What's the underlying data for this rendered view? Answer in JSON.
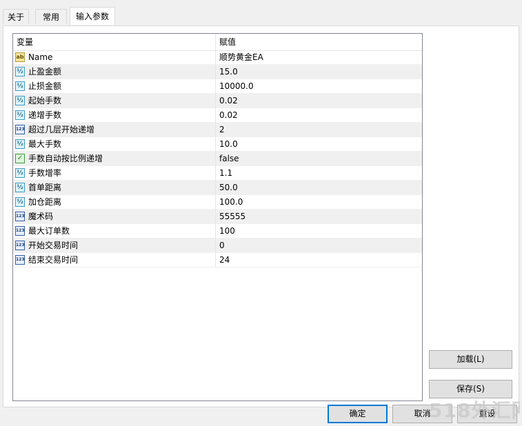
{
  "tabs": [
    {
      "label": "关于",
      "active": false
    },
    {
      "label": "常用",
      "active": false
    },
    {
      "label": "输入参数",
      "active": true
    }
  ],
  "grid": {
    "headers": {
      "variable": "变量",
      "value": "赋值"
    },
    "rows": [
      {
        "type": "abc",
        "icon": "string-type-icon",
        "name": "Name",
        "value": "顺势黄金EA"
      },
      {
        "type": "dbl",
        "icon": "double-type-icon",
        "name": "止盈金额",
        "value": "15.0"
      },
      {
        "type": "dbl",
        "icon": "double-type-icon",
        "name": "止损金额",
        "value": "10000.0"
      },
      {
        "type": "dbl",
        "icon": "double-type-icon",
        "name": "起始手数",
        "value": "0.02"
      },
      {
        "type": "dbl",
        "icon": "double-type-icon",
        "name": "递增手数",
        "value": "0.02"
      },
      {
        "type": "int",
        "icon": "integer-type-icon",
        "name": "超过几层开始递增",
        "value": "2"
      },
      {
        "type": "dbl",
        "icon": "double-type-icon",
        "name": "最大手数",
        "value": "10.0"
      },
      {
        "type": "bool",
        "icon": "boolean-type-icon",
        "name": "手数自动按比例递增",
        "value": "false"
      },
      {
        "type": "dbl",
        "icon": "double-type-icon",
        "name": "手数增率",
        "value": "1.1"
      },
      {
        "type": "dbl",
        "icon": "double-type-icon",
        "name": "首单距离",
        "value": "50.0"
      },
      {
        "type": "dbl",
        "icon": "double-type-icon",
        "name": "加仓距离",
        "value": "100.0"
      },
      {
        "type": "int",
        "icon": "integer-type-icon",
        "name": "魔术码",
        "value": "55555"
      },
      {
        "type": "int",
        "icon": "integer-type-icon",
        "name": "最大订单数",
        "value": "100"
      },
      {
        "type": "int",
        "icon": "integer-type-icon",
        "name": "开始交易时间",
        "value": "0"
      },
      {
        "type": "int",
        "icon": "integer-type-icon",
        "name": "结束交易时间",
        "value": "24"
      }
    ]
  },
  "buttons": {
    "load": "加载(L)",
    "save": "保存(S)",
    "ok": "确定",
    "cancel": "取消",
    "reset": "重设"
  },
  "watermark": "518外汇网",
  "colors": {
    "panel_bg": "#f0f0f0",
    "grid_border": "#828790",
    "default_button_border": "#0078d7"
  }
}
